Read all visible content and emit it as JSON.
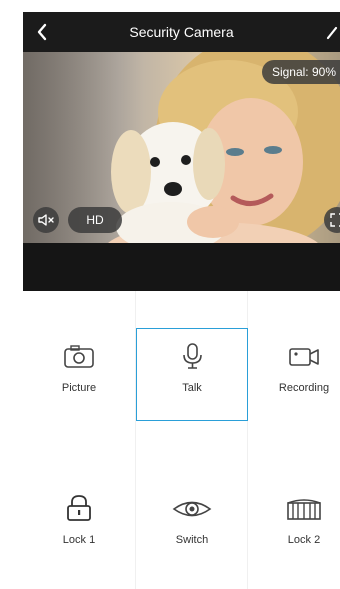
{
  "header": {
    "title": "Security Camera"
  },
  "video": {
    "signal_text": "Signal: 90%",
    "quality_label": "HD"
  },
  "controls": [
    {
      "label": "Picture"
    },
    {
      "label": "Talk"
    },
    {
      "label": "Recording"
    },
    {
      "label": "Lock 1"
    },
    {
      "label": "Switch"
    },
    {
      "label": "Lock 2"
    }
  ],
  "colors": {
    "topbar": "#1b1b1b",
    "accent_border": "#2a9fd8",
    "icon": "#444444",
    "label": "#333333"
  },
  "icons": {
    "header_left": "back-chevron-icon",
    "header_right": "edit-pencil-icon",
    "picture": "camera-icon",
    "talk": "microphone-icon",
    "recording": "video-camera-icon",
    "lock1": "padlock-icon",
    "switch": "eye-icon",
    "lock2": "gate-icon",
    "mute": "speaker-muted-icon",
    "fullscreen": "fullscreen-icon"
  }
}
